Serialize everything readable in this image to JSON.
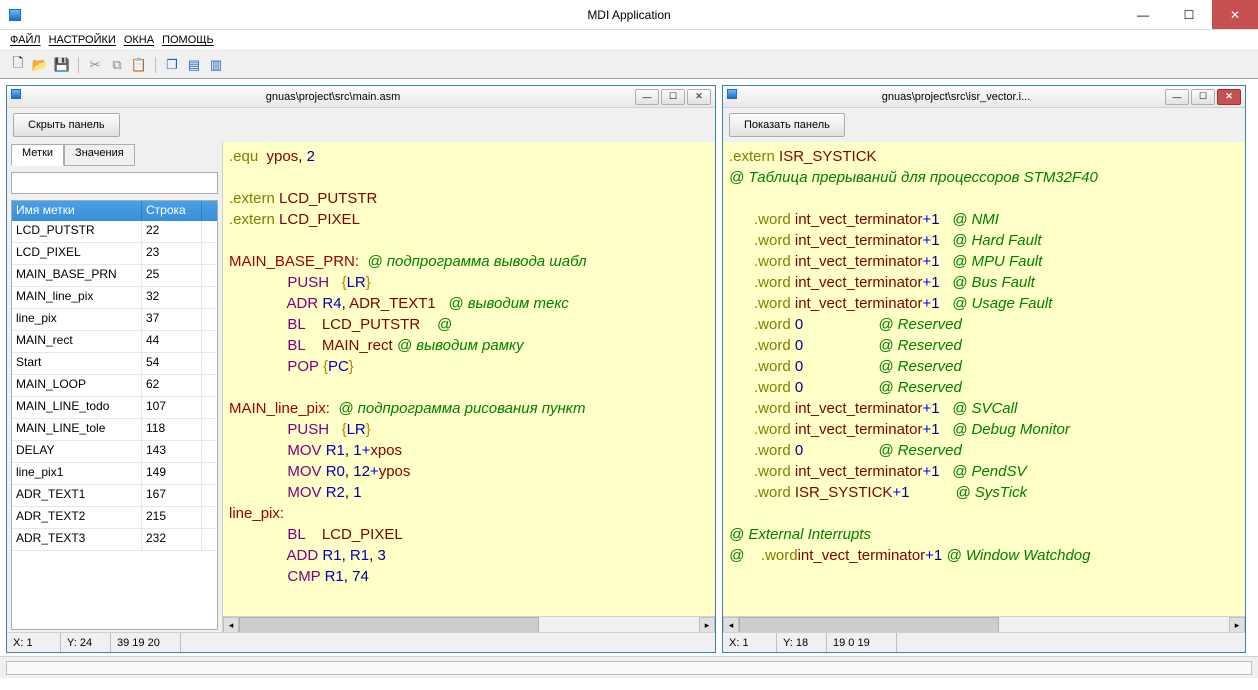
{
  "titlebar": {
    "title": "MDI Application"
  },
  "menus": [
    "ФАЙЛ",
    "НАСТРОЙКИ",
    "ОКНА",
    "ПОМОЩЬ"
  ],
  "window_left": {
    "title": "gnuas\\project\\src\\main.asm",
    "panel_btn": "Скрыть панель",
    "tabs": [
      "Метки",
      "Значения"
    ],
    "headers": [
      "Имя метки",
      "Строка"
    ],
    "rows": [
      [
        "LCD_PUTSTR",
        "22"
      ],
      [
        "LCD_PIXEL",
        "23"
      ],
      [
        "MAIN_BASE_PRN",
        "25"
      ],
      [
        "MAIN_line_pix",
        "32"
      ],
      [
        "line_pix",
        "37"
      ],
      [
        "MAIN_rect",
        "44"
      ],
      [
        "Start",
        "54"
      ],
      [
        "MAIN_LOOP",
        "62"
      ],
      [
        "MAIN_LINE_todo",
        "107"
      ],
      [
        "MAIN_LINE_tole",
        "118"
      ],
      [
        "DELAY",
        "143"
      ],
      [
        "line_pix1",
        "149"
      ],
      [
        "ADR_TEXT1",
        "167"
      ],
      [
        "ADR_TEXT2",
        "215"
      ],
      [
        "ADR_TEXT3",
        "232"
      ]
    ],
    "status": {
      "x": "X: 1",
      "y": "Y: 24",
      "sel": "39 19 20"
    }
  },
  "window_right": {
    "title": "gnuas\\project\\src\\isr_vector.i...",
    "panel_btn": "Показать панель",
    "status": {
      "x": "X: 1",
      "y": "Y: 18",
      "sel": "19 0 19"
    }
  },
  "code_left": [
    [
      [
        "dir",
        ".equ"
      ],
      [
        "pl",
        "  "
      ],
      [
        "sym",
        "ypos"
      ],
      [
        "pl",
        ", "
      ],
      [
        "num",
        "2"
      ]
    ],
    [],
    [
      [
        "dir",
        ".extern"
      ],
      [
        "pl",
        " "
      ],
      [
        "sym",
        "LCD_PUTSTR"
      ]
    ],
    [
      [
        "dir",
        ".extern"
      ],
      [
        "pl",
        " "
      ],
      [
        "sym",
        "LCD_PIXEL"
      ]
    ],
    [],
    [
      [
        "label",
        "MAIN_BASE_PRN:"
      ],
      [
        "pl",
        "  "
      ],
      [
        "cmt",
        "@ подпрограмма вывода шабл"
      ]
    ],
    [
      [
        "pl",
        "              "
      ],
      [
        "kw",
        "PUSH"
      ],
      [
        "pl",
        "   "
      ],
      [
        "brace",
        "{"
      ],
      [
        "reg",
        "LR"
      ],
      [
        "brace",
        "}"
      ]
    ],
    [
      [
        "pl",
        "              "
      ],
      [
        "kw",
        "ADR"
      ],
      [
        "pl",
        " "
      ],
      [
        "reg",
        "R4"
      ],
      [
        "pl",
        ", "
      ],
      [
        "sym",
        "ADR_TEXT1"
      ],
      [
        "pl",
        "   "
      ],
      [
        "cmt",
        "@ выводим текс"
      ]
    ],
    [
      [
        "pl",
        "              "
      ],
      [
        "kw",
        "BL"
      ],
      [
        "pl",
        "    "
      ],
      [
        "sym",
        "LCD_PUTSTR"
      ],
      [
        "pl",
        "    "
      ],
      [
        "cmt",
        "@"
      ]
    ],
    [
      [
        "pl",
        "              "
      ],
      [
        "kw",
        "BL"
      ],
      [
        "pl",
        "    "
      ],
      [
        "sym",
        "MAIN_rect"
      ],
      [
        "pl",
        " "
      ],
      [
        "cmt",
        "@ выводим рамку"
      ]
    ],
    [
      [
        "pl",
        "              "
      ],
      [
        "kw",
        "POP"
      ],
      [
        "pl",
        " "
      ],
      [
        "brace",
        "{"
      ],
      [
        "reg",
        "PC"
      ],
      [
        "brace",
        "}"
      ]
    ],
    [],
    [
      [
        "label",
        "MAIN_line_pix:"
      ],
      [
        "pl",
        "  "
      ],
      [
        "cmt",
        "@ подпрограмма рисования пункт"
      ]
    ],
    [
      [
        "pl",
        "              "
      ],
      [
        "kw",
        "PUSH"
      ],
      [
        "pl",
        "   "
      ],
      [
        "brace",
        "{"
      ],
      [
        "reg",
        "LR"
      ],
      [
        "brace",
        "}"
      ]
    ],
    [
      [
        "pl",
        "              "
      ],
      [
        "kw",
        "MOV"
      ],
      [
        "pl",
        " "
      ],
      [
        "reg",
        "R1"
      ],
      [
        "pl",
        ", "
      ],
      [
        "num",
        "1"
      ],
      [
        "op",
        "+"
      ],
      [
        "sym",
        "xpos"
      ]
    ],
    [
      [
        "pl",
        "              "
      ],
      [
        "kw",
        "MOV"
      ],
      [
        "pl",
        " "
      ],
      [
        "reg",
        "R0"
      ],
      [
        "pl",
        ", "
      ],
      [
        "num",
        "12"
      ],
      [
        "op",
        "+"
      ],
      [
        "sym",
        "ypos"
      ]
    ],
    [
      [
        "pl",
        "              "
      ],
      [
        "kw",
        "MOV"
      ],
      [
        "pl",
        " "
      ],
      [
        "reg",
        "R2"
      ],
      [
        "pl",
        ", "
      ],
      [
        "num",
        "1"
      ]
    ],
    [
      [
        "label",
        "line_pix:"
      ]
    ],
    [
      [
        "pl",
        "              "
      ],
      [
        "kw",
        "BL"
      ],
      [
        "pl",
        "    "
      ],
      [
        "sym",
        "LCD_PIXEL"
      ]
    ],
    [
      [
        "pl",
        "              "
      ],
      [
        "kw",
        "ADD"
      ],
      [
        "pl",
        " "
      ],
      [
        "reg",
        "R1"
      ],
      [
        "pl",
        ", "
      ],
      [
        "reg",
        "R1"
      ],
      [
        "pl",
        ", "
      ],
      [
        "num",
        "3"
      ]
    ],
    [
      [
        "pl",
        "              "
      ],
      [
        "kw",
        "CMP"
      ],
      [
        "pl",
        " "
      ],
      [
        "reg",
        "R1"
      ],
      [
        "pl",
        ", "
      ],
      [
        "num",
        "74"
      ]
    ]
  ],
  "code_right": [
    [
      [
        "dir",
        ".extern"
      ],
      [
        "pl",
        " "
      ],
      [
        "sym",
        "ISR_SYSTICK"
      ]
    ],
    [
      [
        "cmt",
        "@ Таблица прерываний для процессоров STM32F40"
      ]
    ],
    [],
    [
      [
        "pl",
        "      "
      ],
      [
        "dir",
        ".word"
      ],
      [
        "pl",
        " "
      ],
      [
        "sym",
        "int_vect_terminator"
      ],
      [
        "op",
        "+"
      ],
      [
        "num",
        "1"
      ],
      [
        "pl",
        "   "
      ],
      [
        "cmt",
        "@ NMI"
      ]
    ],
    [
      [
        "pl",
        "      "
      ],
      [
        "dir",
        ".word"
      ],
      [
        "pl",
        " "
      ],
      [
        "sym",
        "int_vect_terminator"
      ],
      [
        "op",
        "+"
      ],
      [
        "num",
        "1"
      ],
      [
        "pl",
        "   "
      ],
      [
        "cmt",
        "@ Hard Fault"
      ]
    ],
    [
      [
        "pl",
        "      "
      ],
      [
        "dir",
        ".word"
      ],
      [
        "pl",
        " "
      ],
      [
        "sym",
        "int_vect_terminator"
      ],
      [
        "op",
        "+"
      ],
      [
        "num",
        "1"
      ],
      [
        "pl",
        "   "
      ],
      [
        "cmt",
        "@ MPU Fault"
      ]
    ],
    [
      [
        "pl",
        "      "
      ],
      [
        "dir",
        ".word"
      ],
      [
        "pl",
        " "
      ],
      [
        "sym",
        "int_vect_terminator"
      ],
      [
        "op",
        "+"
      ],
      [
        "num",
        "1"
      ],
      [
        "pl",
        "   "
      ],
      [
        "cmt",
        "@ Bus Fault"
      ]
    ],
    [
      [
        "pl",
        "      "
      ],
      [
        "dir",
        ".word"
      ],
      [
        "pl",
        " "
      ],
      [
        "sym",
        "int_vect_terminator"
      ],
      [
        "op",
        "+"
      ],
      [
        "num",
        "1"
      ],
      [
        "pl",
        "   "
      ],
      [
        "cmt",
        "@ Usage Fault"
      ]
    ],
    [
      [
        "pl",
        "      "
      ],
      [
        "dir",
        ".word"
      ],
      [
        "pl",
        " "
      ],
      [
        "num",
        "0"
      ],
      [
        "pl",
        "                  "
      ],
      [
        "cmt",
        "@ Reserved"
      ]
    ],
    [
      [
        "pl",
        "      "
      ],
      [
        "dir",
        ".word"
      ],
      [
        "pl",
        " "
      ],
      [
        "num",
        "0"
      ],
      [
        "pl",
        "                  "
      ],
      [
        "cmt",
        "@ Reserved"
      ]
    ],
    [
      [
        "pl",
        "      "
      ],
      [
        "dir",
        ".word"
      ],
      [
        "pl",
        " "
      ],
      [
        "num",
        "0"
      ],
      [
        "pl",
        "                  "
      ],
      [
        "cmt",
        "@ Reserved"
      ]
    ],
    [
      [
        "pl",
        "      "
      ],
      [
        "dir",
        ".word"
      ],
      [
        "pl",
        " "
      ],
      [
        "num",
        "0"
      ],
      [
        "pl",
        "                  "
      ],
      [
        "cmt",
        "@ Reserved"
      ]
    ],
    [
      [
        "pl",
        "      "
      ],
      [
        "dir",
        ".word"
      ],
      [
        "pl",
        " "
      ],
      [
        "sym",
        "int_vect_terminator"
      ],
      [
        "op",
        "+"
      ],
      [
        "num",
        "1"
      ],
      [
        "pl",
        "   "
      ],
      [
        "cmt",
        "@ SVCall"
      ]
    ],
    [
      [
        "pl",
        "      "
      ],
      [
        "dir",
        ".word"
      ],
      [
        "pl",
        " "
      ],
      [
        "sym",
        "int_vect_terminator"
      ],
      [
        "op",
        "+"
      ],
      [
        "num",
        "1"
      ],
      [
        "pl",
        "   "
      ],
      [
        "cmt",
        "@ Debug Monitor"
      ]
    ],
    [
      [
        "pl",
        "      "
      ],
      [
        "dir",
        ".word"
      ],
      [
        "pl",
        " "
      ],
      [
        "num",
        "0"
      ],
      [
        "pl",
        "                  "
      ],
      [
        "cmt",
        "@ Reserved"
      ]
    ],
    [
      [
        "pl",
        "      "
      ],
      [
        "dir",
        ".word"
      ],
      [
        "pl",
        " "
      ],
      [
        "sym",
        "int_vect_terminator"
      ],
      [
        "op",
        "+"
      ],
      [
        "num",
        "1"
      ],
      [
        "pl",
        "   "
      ],
      [
        "cmt",
        "@ PendSV"
      ]
    ],
    [
      [
        "pl",
        "      "
      ],
      [
        "dir",
        ".word"
      ],
      [
        "pl",
        " "
      ],
      [
        "sym",
        "ISR_SYSTICK"
      ],
      [
        "op",
        "+"
      ],
      [
        "num",
        "1"
      ],
      [
        "pl",
        "           "
      ],
      [
        "cmt",
        "@ SysTick"
      ]
    ],
    [],
    [
      [
        "cmt",
        "@ External Interrupts"
      ]
    ],
    [
      [
        "cmt",
        "@    "
      ],
      [
        "dir",
        ".word"
      ],
      [
        "sym",
        "int_vect_terminator"
      ],
      [
        "op",
        "+"
      ],
      [
        "num",
        "1"
      ],
      [
        "pl",
        " "
      ],
      [
        "cmt",
        "@ Window Watchdog"
      ]
    ]
  ]
}
